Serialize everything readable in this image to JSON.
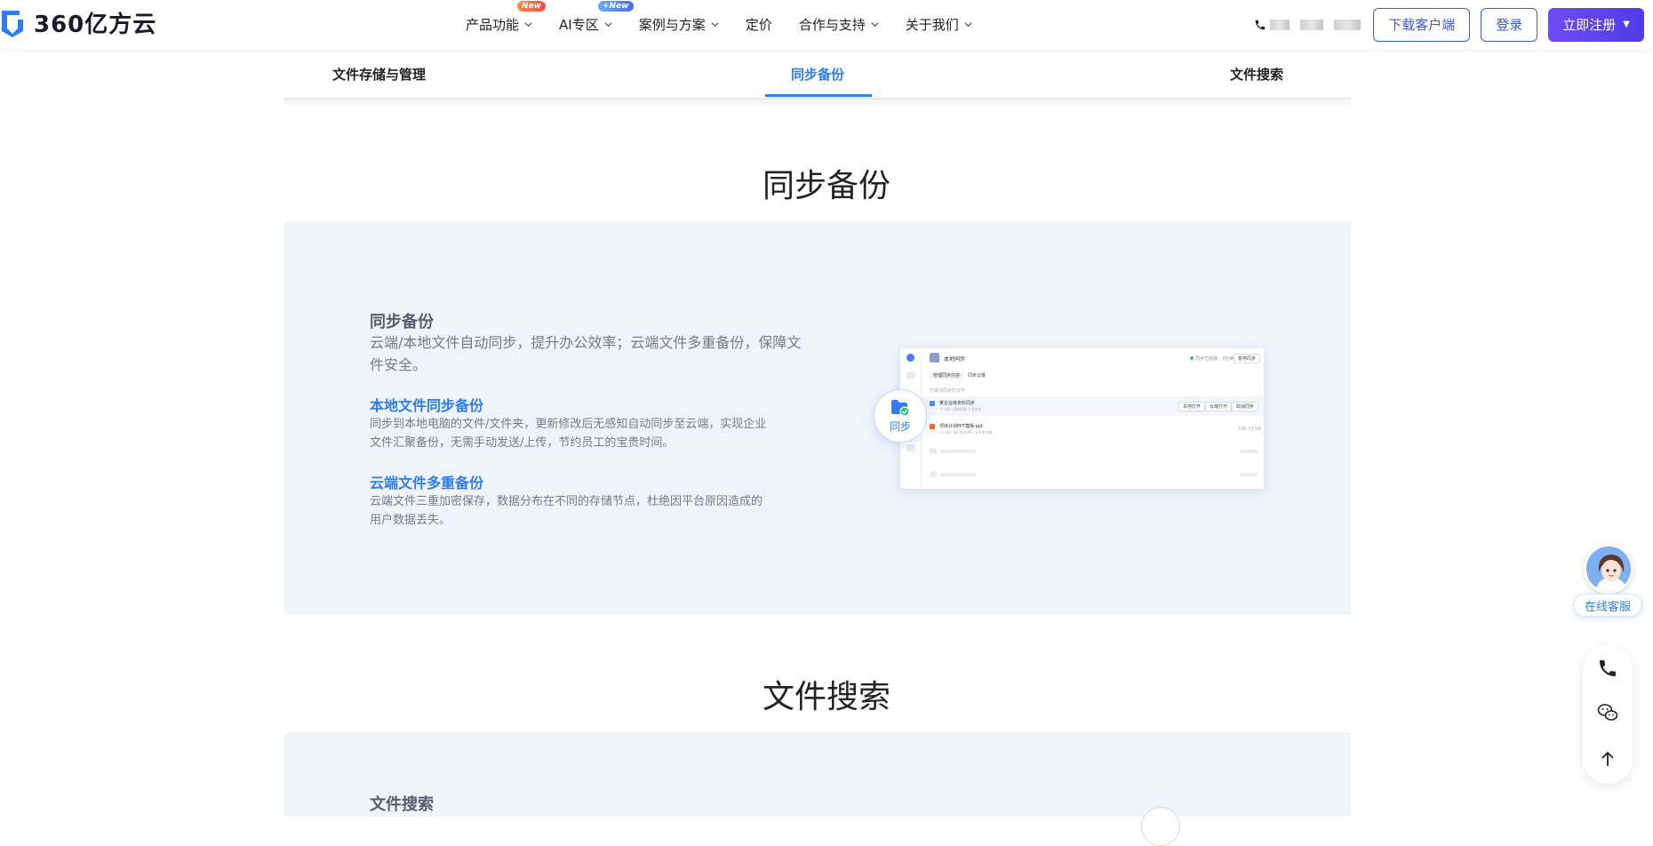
{
  "header": {
    "logo_text": "360亿方云",
    "nav": [
      {
        "label": "产品功能",
        "badge": "New",
        "has_chevron": true
      },
      {
        "label": "AI专区",
        "badge": "+New",
        "has_chevron": true
      },
      {
        "label": "案例与方案",
        "badge": "",
        "has_chevron": true
      },
      {
        "label": "定价",
        "badge": "",
        "has_chevron": false
      },
      {
        "label": "合作与支持",
        "badge": "",
        "has_chevron": true
      },
      {
        "label": "关于我们",
        "badge": "",
        "has_chevron": true
      }
    ],
    "download_label": "下载客户端",
    "login_label": "登录",
    "register_label": "立即注册"
  },
  "subtabs": {
    "items": [
      "文件存储与管理",
      "同步备份",
      "文件搜索"
    ],
    "active": "同步备份"
  },
  "sections": {
    "sync": {
      "title": "同步备份",
      "feature_title": "同步备份",
      "feature_desc_line1": "云端/本地文件自动同步，提升办公效率；云端文件多重备份，保障文",
      "feature_desc_line2": "件安全。",
      "sub1_title": "本地文件同步备份",
      "sub1_desc_line1": "同步到本地电脑的文件/文件夹，更新修改后无感知自动同步至云端，实现企业",
      "sub1_desc_line2": "文件汇聚备份，无需手动发送/上传，节约员工的宝贵时间。",
      "sub2_title": "云端文件多重备份",
      "sub2_desc_line1": "云端文件三重加密保存，数据分布在不同的存储节点，杜绝因平台原因造成的",
      "sub2_desc_line2": "用户数据丢失。",
      "bubble_label": "同步",
      "mock": {
        "title": "本地同步",
        "status": "同步已完成，3分钟前",
        "top_btn": "暂停同步",
        "tab1": "管理同步内容",
        "tab2": "同步记录",
        "hint": "已成功同步的文件",
        "row1_name": "某企业库资料同步",
        "row1_path": "个人库 / 资料同步 / 文件夹",
        "row1_btn1": "本地打开",
        "row1_btn2": "云端打开",
        "row1_btn3": "取消同步",
        "row2_name": "项目计划PPT模板.ppt",
        "row2_path": "个人库 / 部门文件夹 / 公司文档库",
        "row2_size": "436.72 KB"
      }
    },
    "search": {
      "title": "文件搜索",
      "feature_title": "文件搜索"
    }
  },
  "floating": {
    "cs_label": "在线客服"
  },
  "colors": {
    "accent": "#2f7df6",
    "brand_purple": "#5b42ee",
    "panel_bg": "#eff3fa"
  }
}
